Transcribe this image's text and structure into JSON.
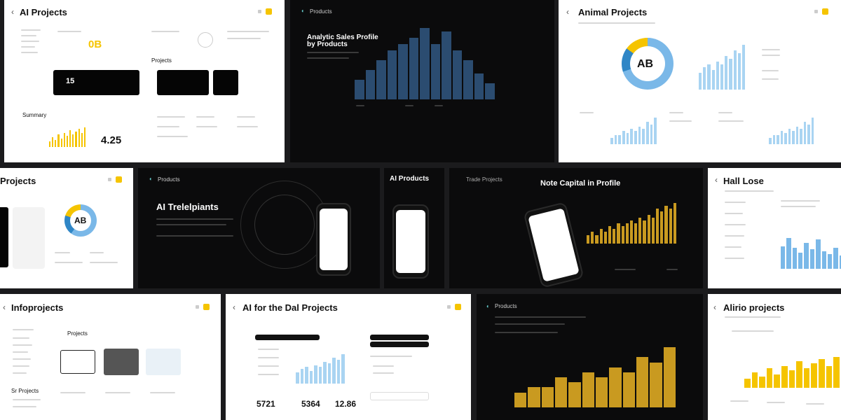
{
  "panels": {
    "p1": {
      "title": "AI Projects",
      "stat_a": "0B",
      "stat_b": "4.25",
      "stat_c": "15",
      "sec_a": "Projects",
      "sec_b": "Summary"
    },
    "p2": {
      "brand": "Products",
      "headline_1": "Analytic Sales Profile",
      "headline_2": "by Products"
    },
    "p3": {
      "title": "Animal Projects",
      "donut_label": "AB"
    },
    "p4": {
      "title": "Projects",
      "donut_label": "AB"
    },
    "p5": {
      "brand": "Products",
      "headline": "AI Trelelpiants"
    },
    "p6": {
      "headline": "AI Products"
    },
    "p7": {
      "brand": "Trade Projects",
      "headline": "Note Capital in Profile"
    },
    "p8": {
      "title": "Hall Lose"
    },
    "p9": {
      "title": "Infoprojects",
      "sec": "Projects",
      "sec2": "Sr Projects"
    },
    "p10": {
      "title": "AI for the Dal Projects",
      "num_1": "5721",
      "num_2": "5364",
      "num_3": "12.86"
    },
    "p11": {
      "brand": "Products"
    },
    "p12": {
      "title": "Alirio projects"
    }
  },
  "colors": {
    "accent_yellow": "#f5c400",
    "accent_blue": "#7ab8e8",
    "dark_blue": "#2b4c70",
    "gold": "#c99a20"
  },
  "chart_data": [
    {
      "type": "bar",
      "values": [
        6,
        9,
        12,
        15,
        17,
        19,
        22,
        17,
        21,
        15,
        12,
        8,
        5
      ]
    },
    {
      "type": "bar",
      "values": [
        14,
        19,
        13,
        10,
        16,
        12,
        18,
        11,
        9,
        13,
        8
      ]
    },
    {
      "type": "bar",
      "values": [
        6,
        8,
        9,
        7,
        10,
        9,
        12,
        11,
        14,
        13,
        16
      ]
    },
    {
      "type": "bar",
      "values": [
        3,
        4,
        3,
        5,
        4,
        6,
        5,
        7,
        6,
        7,
        8,
        7,
        9,
        8,
        10,
        9,
        12,
        11,
        13,
        12,
        14
      ]
    },
    {
      "type": "bar",
      "values": [
        3,
        4,
        4,
        6,
        5,
        7,
        6,
        8,
        7,
        10,
        9,
        12
      ]
    },
    {
      "type": "bar",
      "values": [
        4,
        7,
        5,
        9,
        6,
        10,
        8,
        12,
        9,
        11,
        13,
        10,
        14
      ]
    }
  ]
}
